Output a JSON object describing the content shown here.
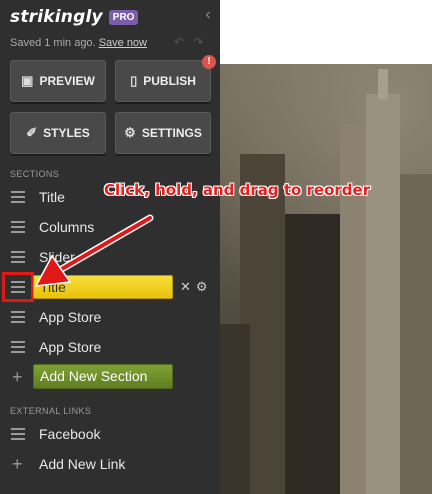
{
  "brand": {
    "name": "strikingly",
    "tier": "PRO"
  },
  "status": {
    "saved_text": "Saved 1 min ago.",
    "save_now": "Save now"
  },
  "toolbar": {
    "preview_label": "PREVIEW",
    "publish_label": "PUBLISH",
    "publish_badge": "!",
    "styles_label": "STYLES",
    "settings_label": "SETTINGS"
  },
  "sections": {
    "heading": "SECTIONS",
    "items": [
      {
        "label": "Title"
      },
      {
        "label": "Columns"
      },
      {
        "label": "Slider"
      },
      {
        "label": "Title",
        "active": true
      },
      {
        "label": "App Store"
      },
      {
        "label": "App Store"
      }
    ],
    "add_label": "Add New Section"
  },
  "external_links": {
    "heading": "EXTERNAL LINKS",
    "items": [
      {
        "label": "Facebook"
      }
    ],
    "add_label": "Add New Link"
  },
  "annotation": {
    "text": "Click, hold, and drag to reorder"
  },
  "colors": {
    "sidebar_bg": "#2f2f2f",
    "active_section": "#f4d10c",
    "add_section_green": "#6f8f2c",
    "annotation_red": "#e01818",
    "pro_badge": "#7b5ea7"
  }
}
